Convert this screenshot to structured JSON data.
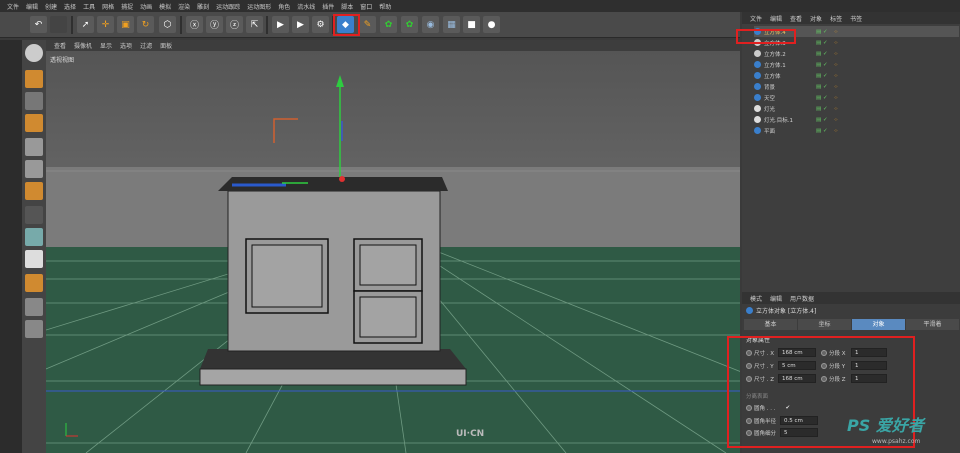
{
  "menubar": [
    "文件",
    "编辑",
    "创建",
    "选择",
    "工具",
    "网格",
    "捕捉",
    "动画",
    "模拟",
    "渲染",
    "雕刻",
    "运动跟踪",
    "运动图形",
    "角色",
    "流水线",
    "插件",
    "脚本",
    "窗口",
    "帮助"
  ],
  "viewport": {
    "menu": [
      "查看",
      "摄像机",
      "显示",
      "选项",
      "过滤",
      "面板"
    ],
    "label": "透视视图"
  },
  "object_manager": {
    "menu": [
      "文件",
      "编辑",
      "查看",
      "对象",
      "标签",
      "书签"
    ],
    "objects": [
      "立方体.4",
      "立方体.3",
      "立方体.2",
      "立方体.1",
      "立方体",
      "背景",
      "天空",
      "灯光",
      "灯光.目标.1",
      "平面"
    ]
  },
  "attributes": {
    "menu": [
      "模式",
      "编辑",
      "用户数据"
    ],
    "title": "立方体对象 [立方体.4]",
    "tabs": [
      "基本",
      "坐标",
      "对象",
      "平滑着"
    ],
    "section": "对象属性",
    "size_rows": [
      {
        "label": "尺寸 . X",
        "value": "168 cm",
        "seg_label": "分段 X",
        "seg": "1"
      },
      {
        "label": "尺寸 . Y",
        "value": "5 cm",
        "seg_label": "分段 Y",
        "seg": "1"
      },
      {
        "label": "尺寸 . Z",
        "value": "168 cm",
        "seg_label": "分段 Z",
        "seg": "1"
      }
    ],
    "separate": "分离表面",
    "fillet_label": "圆角 . . .",
    "fillet_check": "✔",
    "fillet_radius_label": "圆角半径",
    "fillet_radius": "0.5 cm",
    "fillet_sub_label": "圆角细分",
    "fillet_sub": "5"
  },
  "watermark": {
    "logo": "PS 爱好者",
    "url": "www.psahz.com",
    "brand": "UI·CN"
  },
  "colors": {
    "highlight": "#e02020",
    "floor": "#2f5a45",
    "cube": "#9a9a9a"
  }
}
